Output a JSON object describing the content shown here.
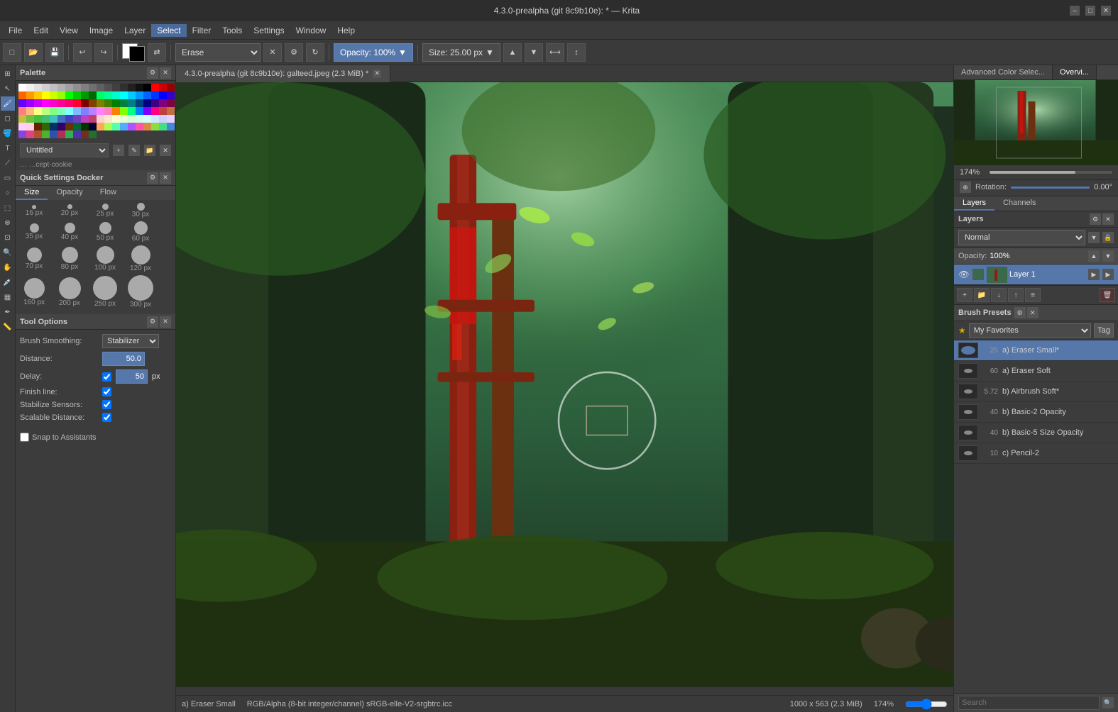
{
  "window": {
    "title": "4.3.0-prealpha (git 8c9b10e): * — Krita",
    "min_btn": "–",
    "max_btn": "□",
    "close_btn": "✕"
  },
  "menubar": {
    "items": [
      "File",
      "Edit",
      "View",
      "Image",
      "Layer",
      "Select",
      "Filter",
      "Tools",
      "Settings",
      "Window",
      "Help"
    ]
  },
  "toolbar": {
    "brush_preset": "Erase",
    "opacity_label": "Opacity: 100%",
    "size_label": "Size: 25.00 px"
  },
  "palette": {
    "title": "Palette",
    "name": "Untitled",
    "bottom_text": "...cept-cookie"
  },
  "quick_settings": {
    "title": "Quick Settings Docker",
    "tabs": [
      "Size",
      "Opacity",
      "Flow"
    ],
    "active_tab": "Size",
    "sizes": [
      {
        "px": "16 px",
        "r": 6
      },
      {
        "px": "20 px",
        "r": 7
      },
      {
        "px": "25 px",
        "r": 9
      },
      {
        "px": "30 px",
        "r": 11
      },
      {
        "px": "35 px",
        "r": 13
      },
      {
        "px": "40 px",
        "r": 15
      },
      {
        "px": "50 px",
        "r": 17
      },
      {
        "px": "60 px",
        "r": 19
      },
      {
        "px": "70 px",
        "r": 21
      },
      {
        "px": "80 px",
        "r": 23
      },
      {
        "px": "100 px",
        "r": 25
      },
      {
        "px": "120 px",
        "r": 27
      },
      {
        "px": "160 px",
        "r": 29
      },
      {
        "px": "200 px",
        "r": 31
      },
      {
        "px": "250 px",
        "r": 34
      },
      {
        "px": "300 px",
        "r": 36
      }
    ]
  },
  "tool_options": {
    "title": "Tool Options",
    "brush_smoothing_label": "Brush Smoothing:",
    "brush_smoothing_value": "Stabilizer",
    "distance_label": "Distance:",
    "distance_value": "50.0",
    "delay_label": "Delay:",
    "delay_value": "50",
    "delay_unit": "px",
    "finish_line_label": "Finish line:",
    "stabilize_sensors_label": "Stabilize Sensors:",
    "scalable_distance_label": "Scalable Distance:"
  },
  "snap": {
    "label": "Snap to Assistants"
  },
  "canvas": {
    "tab_title": "4.3.0-prealpha (git 8c9b10e): galteed.jpeg (2.3 MiB) *"
  },
  "status_bar": {
    "color_info": "RGB/Alpha (8-bit integer/channel)  sRGB-elle-V2-srgbtrc.icc",
    "dimensions": "1000 x 563 (2.3 MiB)",
    "zoom": "174%"
  },
  "right_panel": {
    "overview_tabs": [
      "Advanced Color Selec...",
      "Overvi..."
    ],
    "active_overview_tab": "Overvi...",
    "zoom_value": "174%",
    "rotation_label": "Rotation:",
    "rotation_value": "0.00°"
  },
  "layers": {
    "title": "Layers",
    "tabs": [
      "Layers",
      "Channels"
    ],
    "active_tab": "Layers",
    "blend_mode": "Normal",
    "opacity": "100%",
    "opacity_label": "Opacity:",
    "items": [
      {
        "name": "Layer 1",
        "visible": true
      }
    ],
    "toolbar_btns": [
      "+",
      "📁",
      "↓",
      "↑",
      "≡",
      "🗑"
    ]
  },
  "brush_presets": {
    "title": "Brush Presets",
    "favorites_label": "My Favorites",
    "tag_label": "Tag",
    "items": [
      {
        "num": "25",
        "name": "a) Eraser Small*",
        "active": true
      },
      {
        "num": "60",
        "name": "a) Eraser Soft",
        "active": false
      },
      {
        "num": "5.72",
        "name": "b) Airbrush Soft*",
        "active": false
      },
      {
        "num": "40",
        "name": "b) Basic-2 Opacity",
        "active": false
      },
      {
        "num": "40",
        "name": "b) Basic-5 Size Opacity",
        "active": false
      },
      {
        "num": "10",
        "name": "c) Pencil-2",
        "active": false
      }
    ],
    "search_placeholder": "Search"
  },
  "palette_colors": [
    "#ffffff",
    "#f0f0f0",
    "#e0e0e0",
    "#d0d0d0",
    "#c0c0c0",
    "#b0b0b0",
    "#a0a0a0",
    "#909090",
    "#808080",
    "#707070",
    "#606060",
    "#505050",
    "#404040",
    "#303030",
    "#202020",
    "#101010",
    "#000000",
    "#ff0000",
    "#cc0000",
    "#990000",
    "#ff6600",
    "#ff9900",
    "#ffcc00",
    "#ffff00",
    "#ccff00",
    "#99ff00",
    "#00ff00",
    "#00cc00",
    "#009900",
    "#006600",
    "#00ff66",
    "#00ff99",
    "#00ffcc",
    "#00ffff",
    "#00ccff",
    "#0099ff",
    "#0066ff",
    "#0033ff",
    "#0000ff",
    "#3300cc",
    "#6600ff",
    "#9900ff",
    "#cc00ff",
    "#ff00ff",
    "#ff00cc",
    "#ff0099",
    "#ff0066",
    "#ff0033",
    "#800000",
    "#804000",
    "#808000",
    "#408000",
    "#008000",
    "#008040",
    "#008080",
    "#004080",
    "#000080",
    "#400080",
    "#800080",
    "#800040",
    "#ff8080",
    "#ffbb80",
    "#ffff80",
    "#bbff80",
    "#80ff80",
    "#80ffbb",
    "#80ffff",
    "#80bbff",
    "#8080ff",
    "#bb80ff",
    "#ff80ff",
    "#ff80bb",
    "#ff8000",
    "#80ff00",
    "#00ff80",
    "#0080ff",
    "#8000ff",
    "#ff0080",
    "#c04040",
    "#c07040",
    "#c0c040",
    "#70c040",
    "#40c040",
    "#40c070",
    "#40c0c0",
    "#4070c0",
    "#4040c0",
    "#7040c0",
    "#c040c0",
    "#c04070",
    "#ffd0d0",
    "#ffe8d0",
    "#ffffd0",
    "#e8ffd0",
    "#d0ffd0",
    "#d0ffe8",
    "#d0ffff",
    "#d0e8ff",
    "#d0d0ff",
    "#e8d0ff",
    "#ffd0ff",
    "#ffd0e8",
    "#662200",
    "#336600",
    "#003366",
    "#330066",
    "#663300",
    "#006633",
    "#003300",
    "#000033",
    "#ffaa55",
    "#aaff55",
    "#55ffaa",
    "#55aaff",
    "#aa55ff",
    "#ff55aa",
    "#dd8844",
    "#88dd44",
    "#44dd88",
    "#4488dd",
    "#8844dd",
    "#dd4488",
    "#b05030",
    "#50b030",
    "#3050b0",
    "#b03050",
    "#30b050",
    "#5030b0",
    "#703020",
    "#207030"
  ]
}
